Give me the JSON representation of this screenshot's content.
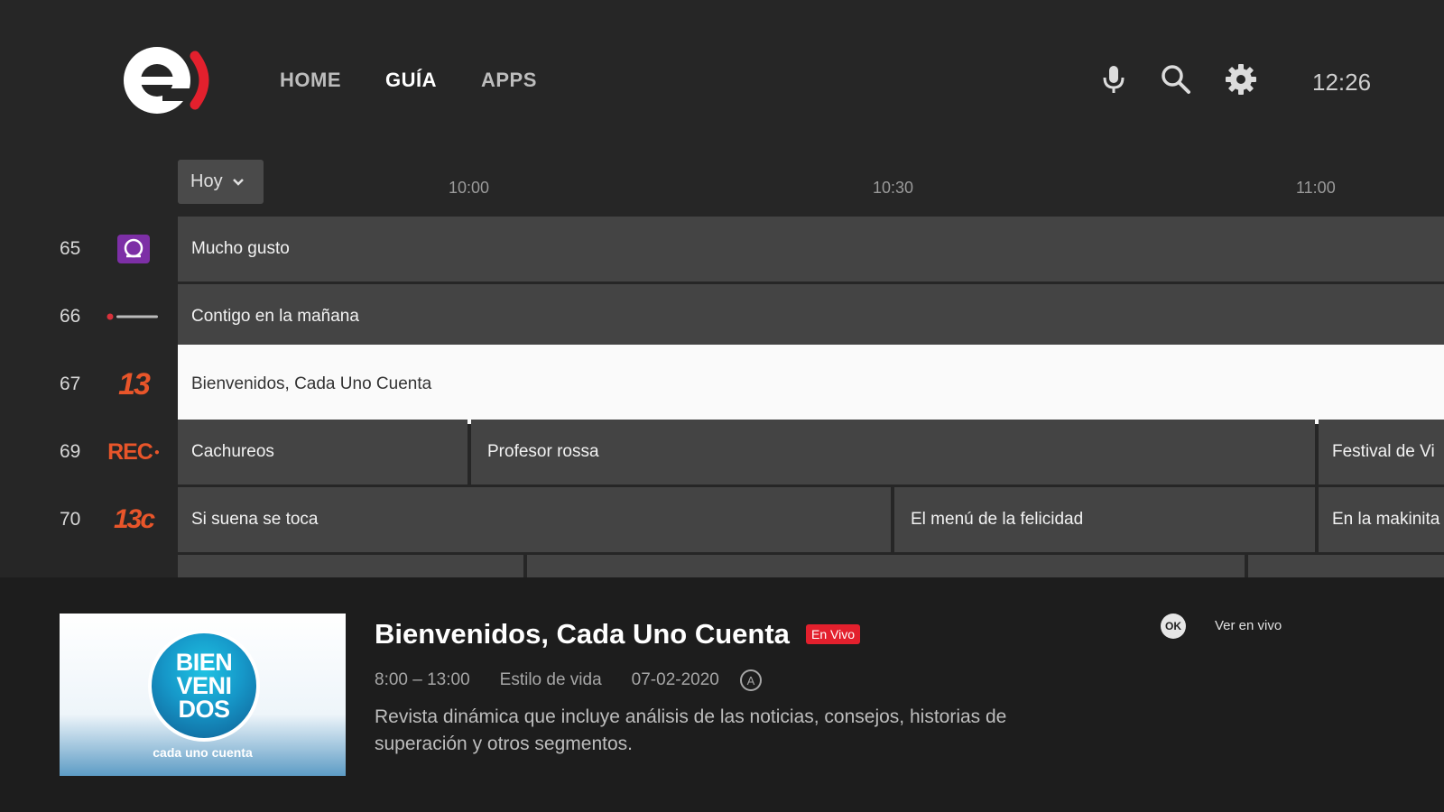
{
  "header": {
    "logo_letter": "e",
    "nav": [
      "HOME",
      "GUÍA",
      "APPS"
    ],
    "active_nav": "GUÍA",
    "icons": [
      "mic-icon",
      "search-icon",
      "gear-icon"
    ],
    "clock": "12:26"
  },
  "guide": {
    "date_select": "Hoy",
    "time_labels": [
      "10:00",
      "10:30",
      "11:00"
    ],
    "channels": [
      {
        "number": "65",
        "logo": "",
        "programs": [
          "Mucho gusto"
        ]
      },
      {
        "number": "66",
        "logo": "",
        "programs": [
          "Contigo en la mañana"
        ]
      },
      {
        "number": "67",
        "logo": "13",
        "programs": [
          "Bienvenidos, Cada Uno Cuenta"
        ],
        "selected": true
      },
      {
        "number": "69",
        "logo": "REC",
        "programs": [
          "Cachureos",
          "Profesor rossa",
          "Festival de Vi"
        ]
      },
      {
        "number": "70",
        "logo": "13c",
        "programs": [
          "Si suena se toca",
          "El menú de la felicidad",
          "En la makinita"
        ]
      }
    ]
  },
  "detail": {
    "title": "Bienvenidos, Cada Uno Cuenta",
    "live_badge": "En Vivo",
    "time_range": "8:00 – 13:00",
    "genre": "Estilo de vida",
    "date": "07-02-2020",
    "rating": "A",
    "description": "Revista dinámica que incluye análisis de las noticias, consejos, historias de superación y otros segmentos.",
    "thumb_lines": [
      "BIEN",
      "VENI",
      "DOS"
    ],
    "thumb_caption": "cada uno cuenta",
    "ok_key": "OK",
    "action_label": "Ver en vivo"
  },
  "colors": {
    "background": "#262626",
    "program_cell": "#444444",
    "selected_cell": "#fafafa",
    "accent_red": "#e3202d",
    "channel_13_orange": "#e8552a"
  }
}
